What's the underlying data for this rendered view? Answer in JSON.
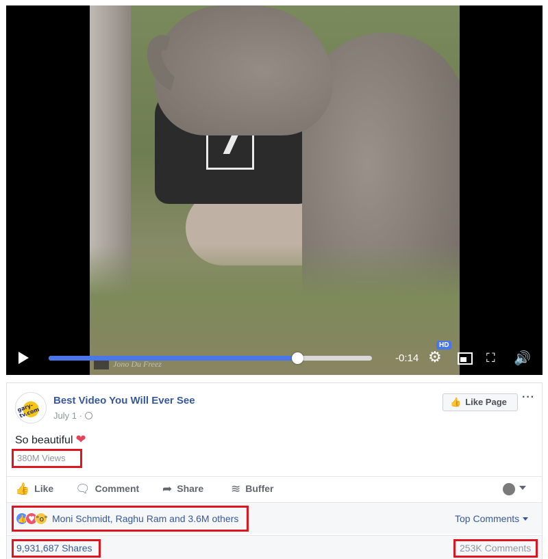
{
  "video": {
    "time_remaining": "-0:14",
    "progress": 0.77,
    "hd_label": "HD",
    "watermark": "Jono Du Freez",
    "shirt_logo": "7"
  },
  "post": {
    "page_name": "Best Video You Will Ever See",
    "avatar_text": "gary-tv.com",
    "date": "July 1",
    "like_page_label": "Like Page",
    "more_label": "···",
    "text": "So beautiful",
    "heart": "❤",
    "views": "380M Views"
  },
  "actions": {
    "like": "Like",
    "comment": "Comment",
    "share": "Share",
    "buffer": "Buffer"
  },
  "reactions": {
    "summary": "Moni Schmidt, Raghu Ram and 3.6M others",
    "top_comments": "Top Comments"
  },
  "stats": {
    "shares": "9,931,687 Shares",
    "comments": "253K Comments"
  },
  "colors": {
    "accent": "#365899",
    "progress": "#4a76e8",
    "highlight_box": "#e0141e"
  },
  "icons": {
    "play": "play-icon",
    "settings": "gear-icon",
    "pip": "picture-in-picture-icon",
    "fullscreen": "fullscreen-icon",
    "volume": "volume-icon",
    "like": "thumbs-up-icon",
    "comment": "comment-bubble-icon",
    "share": "share-arrow-icon",
    "buffer": "buffer-stack-icon"
  }
}
